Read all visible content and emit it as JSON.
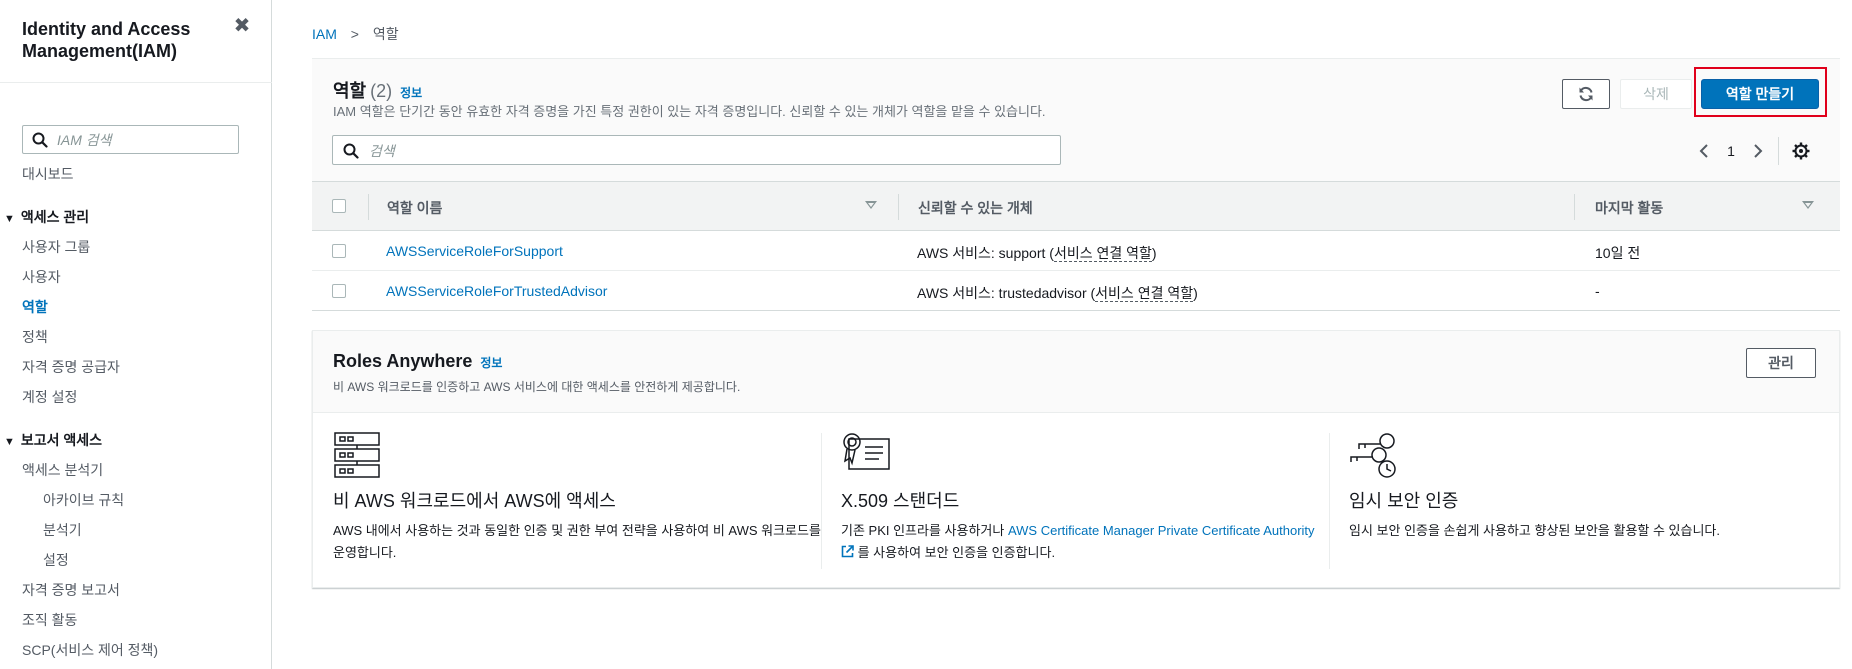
{
  "sidebar": {
    "title": "Identity and Access Management(IAM)",
    "search_placeholder": "IAM 검색",
    "dashboard": "대시보드",
    "sections": [
      {
        "label": "액세스 관리",
        "items": [
          "사용자 그룹",
          "사용자",
          "역할",
          "정책",
          "자격 증명 공급자",
          "계정 설정"
        ]
      },
      {
        "label": "보고서 액세스",
        "items": [
          "액세스 분석기",
          "아카이브 규칙",
          "분석기",
          "설정",
          "자격 증명 보고서",
          "조직 활동",
          "SCP(서비스 제어 정책)"
        ]
      }
    ],
    "active_item": "역할"
  },
  "breadcrumb": {
    "root": "IAM",
    "separator": ">",
    "current": "역할"
  },
  "roles": {
    "title": "역할",
    "count": "(2)",
    "info": "정보",
    "description": "IAM 역할은 단기간 동안 유효한 자격 증명을 가진 특정 권한이 있는 자격 증명입니다. 신뢰할 수 있는 개체가 역할을 맡을 수 있습니다.",
    "delete_label": "삭제",
    "create_label": "역할 만들기",
    "search_placeholder": "검색",
    "page": "1",
    "columns": [
      "역할 이름",
      "신뢰할 수 있는 개체",
      "마지막 활동"
    ],
    "rows": [
      {
        "name": "AWSServiceRoleForSupport",
        "entity_prefix": "AWS 서비스: support (",
        "entity_link": "서비스 연결 역할",
        "entity_suffix": ")",
        "last_activity": "10일 전"
      },
      {
        "name": "AWSServiceRoleForTrustedAdvisor",
        "entity_prefix": "AWS 서비스: trustedadvisor (",
        "entity_link": "서비스 연결 역할",
        "entity_suffix": ")",
        "last_activity": "-"
      }
    ]
  },
  "roles_anywhere": {
    "title": "Roles Anywhere",
    "info": "정보",
    "description": "비 AWS 워크로드를 인증하고 AWS 서비스에 대한 액세스를 안전하게 제공합니다.",
    "manage_label": "관리",
    "columns": [
      {
        "heading": "비 AWS 워크로드에서 AWS에 액세스",
        "text": "AWS 내에서 사용하는 것과 동일한 인증 및 권한 부여 전략을 사용하여 비 AWS 워크로드를 운영합니다.",
        "icon": "server-rack-icon"
      },
      {
        "heading": "X.509 스탠더드",
        "text_prefix": "기존 PKI 인프라를 사용하거나 ",
        "link": "AWS Certificate Manager Private Certificate Authority",
        "text_suffix": " 를 사용하여 보안 인증을 인증합니다.",
        "icon": "certificate-icon"
      },
      {
        "heading": "임시 보안 인증",
        "text": "임시 보안 인증을 손쉽게 사용하고 향상된 보안을 활용할 수 있습니다.",
        "icon": "keys-clock-icon"
      }
    ]
  },
  "colors": {
    "accent": "#0073bb",
    "primary_button": "#0073bb",
    "highlight": "#e0001b"
  }
}
